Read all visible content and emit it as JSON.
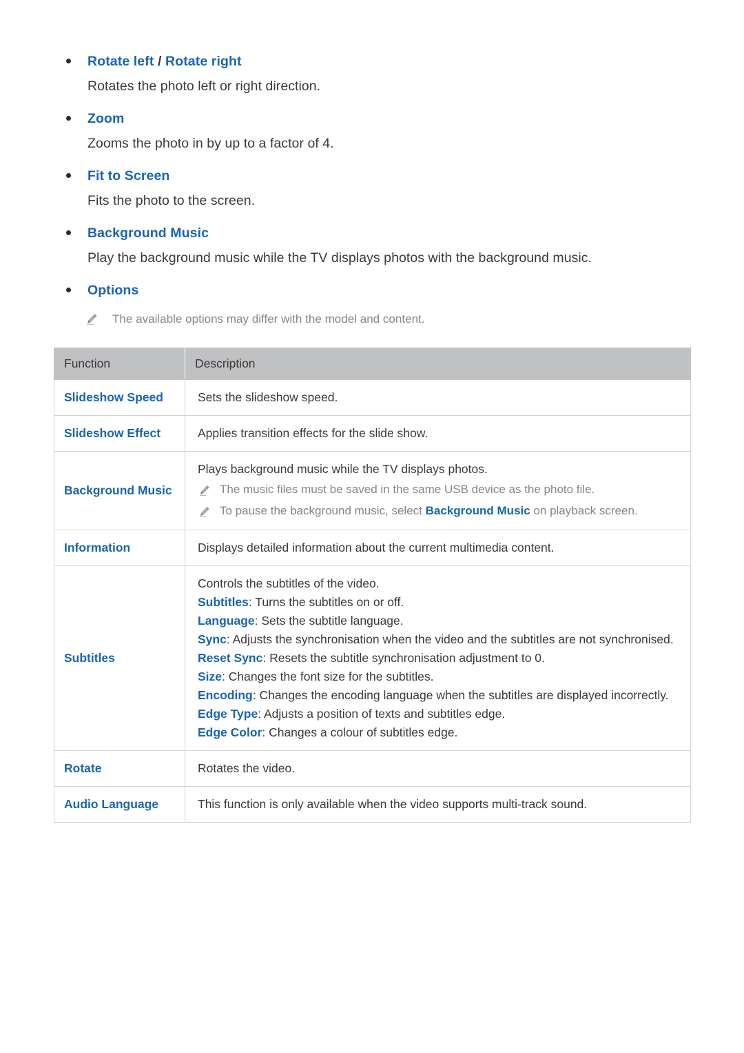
{
  "sections": [
    {
      "title_parts": [
        {
          "text": "Rotate left",
          "type": "link"
        },
        {
          "text": " / ",
          "type": "sep"
        },
        {
          "text": "Rotate right",
          "type": "link"
        }
      ],
      "body": "Rotates the photo left or right direction."
    },
    {
      "title_parts": [
        {
          "text": "Zoom",
          "type": "link"
        }
      ],
      "body": "Zooms the photo in by up to a factor of 4."
    },
    {
      "title_parts": [
        {
          "text": "Fit to Screen",
          "type": "link"
        }
      ],
      "body": "Fits the photo to the screen."
    },
    {
      "title_parts": [
        {
          "text": "Background Music",
          "type": "link"
        }
      ],
      "body": "Play the background music while the TV displays photos with the background music."
    },
    {
      "title_parts": [
        {
          "text": "Options",
          "type": "link"
        }
      ],
      "note": "The available options may differ with the model and content."
    }
  ],
  "section_titles": {
    "rotate_left": "Rotate left",
    "separator": " / ",
    "rotate_right": "Rotate right",
    "rotate_body": "Rotates the photo left or right direction.",
    "zoom": "Zoom",
    "zoom_body": "Zooms the photo in by up to a factor of 4.",
    "fit_to_screen": "Fit to Screen",
    "fit_body": "Fits the photo to the screen.",
    "background_music": "Background Music",
    "background_music_body": "Play the background music while the TV displays photos with the background music.",
    "options": "Options",
    "options_note": "The available options may differ with the model and content."
  },
  "table": {
    "headers": [
      "Function",
      "Description"
    ],
    "rows": [
      {
        "function": "Slideshow Speed",
        "description": "Sets the slideshow speed."
      },
      {
        "function": "Slideshow Effect",
        "description": "Applies transition effects for the slide show."
      },
      {
        "function": "Background Music",
        "description": "Plays background music while the TV displays photos.",
        "notes": [
          {
            "before": "The music files must be saved in the same USB device as the photo file.",
            "highlight": "",
            "after": ""
          },
          {
            "before": "To pause the background music, select ",
            "highlight": "Background Music",
            "after": " on playback screen."
          }
        ]
      },
      {
        "function": "Information",
        "description": "Displays detailed information about the current multimedia content."
      },
      {
        "function": "Subtitles",
        "description": "Controls the subtitles of the video.",
        "items": [
          {
            "key": "Subtitles",
            "text": ": Turns the subtitles on or off."
          },
          {
            "key": "Language",
            "text": ": Sets the subtitle language."
          },
          {
            "key": "Sync",
            "text": ": Adjusts the synchronisation when the video and the subtitles are not synchronised."
          },
          {
            "key": "Reset Sync",
            "text": ": Resets the subtitle synchronisation adjustment to 0."
          },
          {
            "key": "Size",
            "text": ": Changes the font size for the subtitles."
          },
          {
            "key": "Encoding",
            "text": ": Changes the encoding language when the subtitles are displayed incorrectly."
          },
          {
            "key": "Edge Type",
            "text": ": Adjusts a position of texts and subtitles edge."
          },
          {
            "key": "Edge Color",
            "text": ": Changes a colour of subtitles edge."
          }
        ]
      },
      {
        "function": "Rotate",
        "description": "Rotates the video."
      },
      {
        "function": "Audio Language",
        "description": "This function is only available when the video supports multi-track sound."
      }
    ]
  },
  "colors": {
    "link_blue": "#1a65b0",
    "body_text": "#3a3a3a",
    "note_gray": "#858585",
    "table_header_bg": "#c0c1c3",
    "table_border": "#d3d4d6"
  },
  "icons": {
    "note_pencil": "pencil-icon",
    "bullet": "bullet-dot"
  }
}
